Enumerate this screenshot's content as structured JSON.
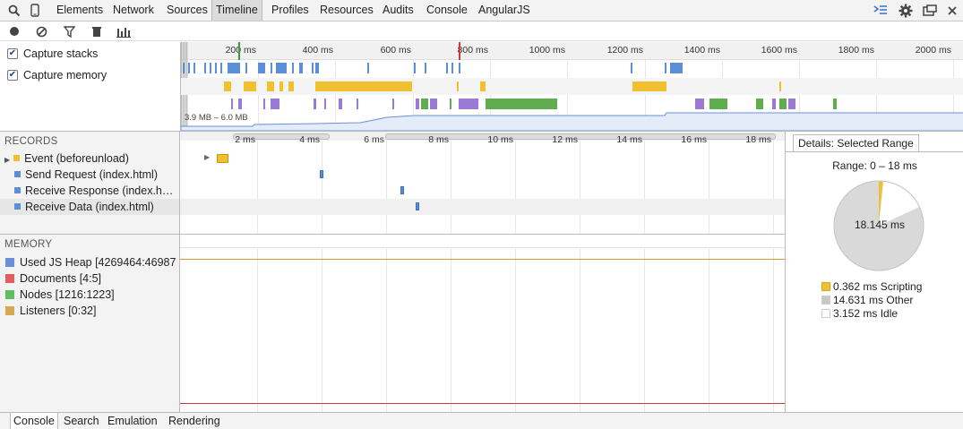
{
  "tabs": [
    "Elements",
    "Network",
    "Sources",
    "Timeline",
    "Profiles",
    "Resources",
    "Audits",
    "Console",
    "AngularJS"
  ],
  "active_tab": "Timeline",
  "options": {
    "capture_stacks": "Capture stacks",
    "capture_memory": "Capture memory"
  },
  "overview": {
    "ticks": [
      "200 ms",
      "400 ms",
      "600 ms",
      "800 ms",
      "1000 ms",
      "1200 ms",
      "1400 ms",
      "1600 ms",
      "1800 ms",
      "2000 ms"
    ],
    "memory_range": "3.9 MB – 6.0 MB"
  },
  "records": {
    "heading": "RECORDS",
    "items": [
      {
        "label": "Event (beforeunload)",
        "color": "#f0c030"
      },
      {
        "label": "Send Request (index.html)",
        "color": "#5b8fd6"
      },
      {
        "label": "Receive Response (index.h…",
        "color": "#5b8fd6"
      },
      {
        "label": "Receive Data (index.html)",
        "color": "#5b8fd6"
      }
    ],
    "ticks": [
      "2 ms",
      "4 ms",
      "6 ms",
      "8 ms",
      "10 ms",
      "12 ms",
      "14 ms",
      "16 ms",
      "18 ms"
    ]
  },
  "details": {
    "tab_label": "Details: Selected Range",
    "range": "Range: 0 – 18 ms",
    "center": "18.145 ms",
    "pie": {
      "scripting": 0.362,
      "other": 14.631,
      "idle": 3.152
    },
    "legend": [
      {
        "label": "0.362 ms Scripting",
        "color": "#f0c030"
      },
      {
        "label": "14.631 ms Other",
        "color": "#c8c8c8"
      },
      {
        "label": "3.152 ms Idle",
        "color": "#ffffff"
      }
    ]
  },
  "memory": {
    "heading": "MEMORY",
    "items": [
      {
        "label": "Used JS Heap [4269464:46987",
        "color": "#6b8fd6"
      },
      {
        "label": "Documents [4:5]",
        "color": "#e06060"
      },
      {
        "label": "Nodes [1216:1223]",
        "color": "#60c060"
      },
      {
        "label": "Listeners [0:32]",
        "color": "#d8a850"
      }
    ]
  },
  "drawer_tabs": [
    "Console",
    "Search",
    "Emulation",
    "Rendering"
  ],
  "drawer_active": "Console"
}
